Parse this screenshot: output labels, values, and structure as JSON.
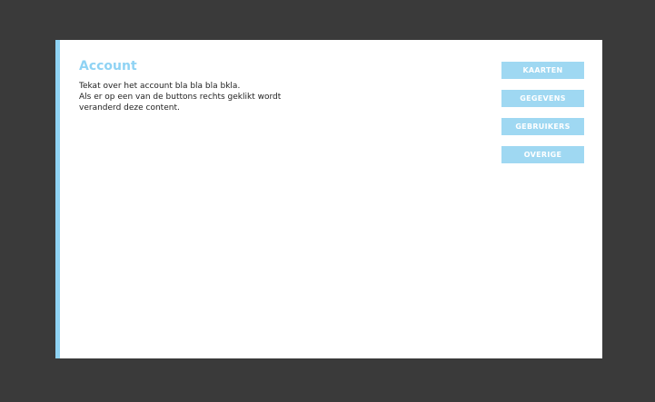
{
  "account": {
    "title": "Account",
    "description_lines": [
      "Tekat over het account bla bla bla bkla.",
      "Als er op een van de buttons rechts geklikt wordt",
      "veranderd deze content."
    ]
  },
  "nav": {
    "kaarten_label": "KAARTEN",
    "gegevens_label": "GEGEVENS",
    "gebruikers_label": "GEBRUIKERS",
    "overige_label": "OVERIGE"
  },
  "colors": {
    "accent": "#8fd3f4",
    "button_bg": "#9fd8f2",
    "backdrop": "#3a3a3a",
    "panel_bg": "#ffffff"
  }
}
